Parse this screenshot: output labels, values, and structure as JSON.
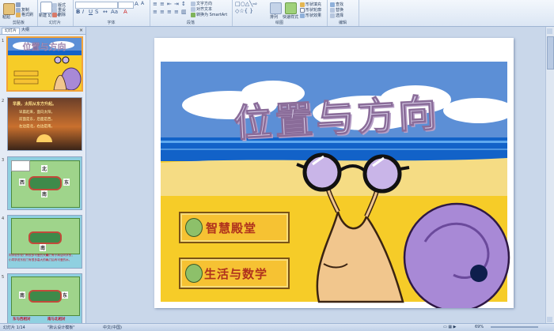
{
  "ribbon": {
    "clipboard": {
      "label": "剪贴板",
      "paste": "粘贴",
      "copy": "复制",
      "format_painter": "格式刷"
    },
    "slides": {
      "label": "幻灯片",
      "new_slide": "新建\n幻灯片",
      "layout": "版式",
      "reset": "重设",
      "delete": "删除"
    },
    "font": {
      "label": "字体"
    },
    "paragraph": {
      "label": "段落",
      "text_direction": "文字方向",
      "align_text": "对齐文本",
      "smartart": "转换为 SmartArt"
    },
    "drawing": {
      "label": "绘图",
      "arrange": "排列",
      "quick_styles": "快速样式",
      "shape_fill": "形状填充",
      "shape_outline": "形状轮廓",
      "shape_effects": "形状效果"
    },
    "editing": {
      "label": "编辑",
      "find": "查找",
      "replace": "替换",
      "select": "选择"
    }
  },
  "panel": {
    "tab_slides": "幻灯片",
    "tab_outline": "大纲",
    "close": "×",
    "slide_numbers": [
      "1",
      "2",
      "3",
      "4",
      "5"
    ],
    "thumb2_lines": [
      "早晨，太阳从东方升起。",
      "早晨起来，面向太阳，",
      "前面是东，后面是西，",
      "左边是北，右边是南。"
    ],
    "thumb_labels": {
      "east": "东",
      "west": "西",
      "south": "南",
      "north": "北"
    },
    "thumb4_lines": [
      "同学说东校门有很多可爱的大树，",
      "小同学说东校门有很多高大的树。",
      "南门有小商店同学的，",
      "人门后有可爱的水。"
    ],
    "thumb5_bottom": [
      "东与西相对",
      "南与北相对"
    ]
  },
  "slide": {
    "title": "位置与方向",
    "button1": "智慧殿堂",
    "button2": "生活与数学"
  },
  "status": {
    "slide_count": "幻灯片 1/14",
    "theme": "\"默认设计模板\"",
    "language": "中文(中国)",
    "zoom": "69%"
  },
  "colors": {
    "sky": "#5c8fd6",
    "sea": "#1262c8",
    "sand": "#f6cc28",
    "button_fill": "#f6c233",
    "button_border": "#7a5316",
    "title_fill": "#d9cfe8",
    "shell": "#a889d6"
  }
}
